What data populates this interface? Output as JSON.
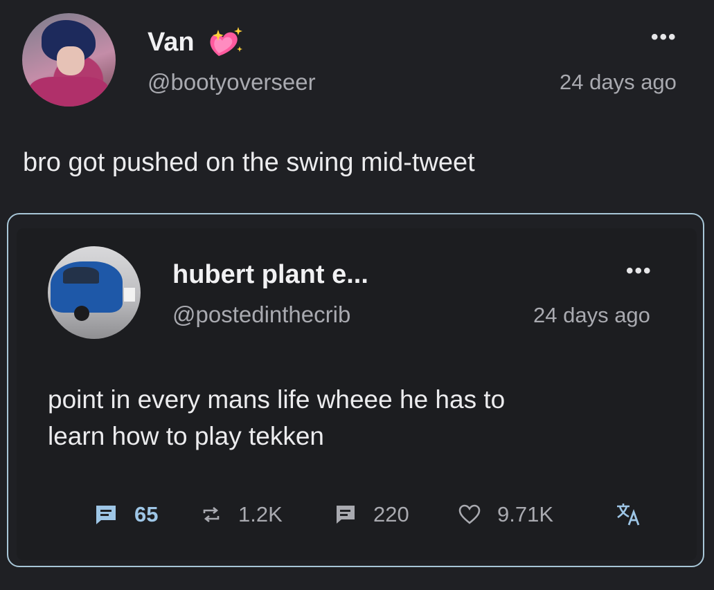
{
  "outer_post": {
    "display_name": "Van",
    "handle": "@bootyoverseer",
    "time": "24 days ago",
    "menu_glyph": "•••",
    "text": "bro got pushed on the swing mid-tweet",
    "avatar_icon": "anime-avatar",
    "name_emoji_icon": "sparkling-heart-icon"
  },
  "quoted_post": {
    "display_name": "hubert plant e...",
    "handle": "@postedinthecrib",
    "time": "24 days ago",
    "menu_glyph": "•••",
    "text_line1": "point in every mans life wheee he has to",
    "text_line2": "learn how to play tekken",
    "avatar_icon": "blue-car-avatar"
  },
  "actions": {
    "comments": "65",
    "retweets": "1.2K",
    "quotes": "220",
    "likes": "9.71K"
  },
  "colors": {
    "background": "#1f2024",
    "card_border": "#a8c7d8",
    "accent": "#9ec6e6",
    "muted_text": "#a9aab0"
  }
}
